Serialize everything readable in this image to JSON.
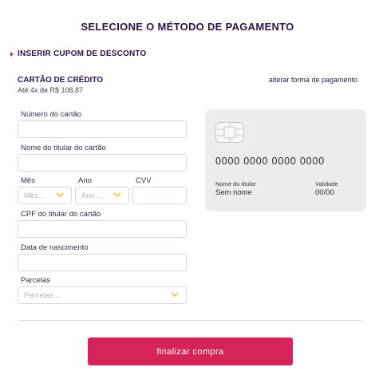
{
  "page": {
    "title": "SELECIONE O MÉTODO DE PAGAMENTO"
  },
  "coupon": {
    "label": "INSERIR CUPOM DE DESCONTO"
  },
  "method": {
    "title": "CARTÃO DE CRÉDITO",
    "installments_text": "Até 4x de R$ 108,87",
    "change_link": "alterar forma de pagamento"
  },
  "form": {
    "card_number_label": "Número do cartão",
    "holder_name_label": "Nome do titular do cartão",
    "month_label": "Mês",
    "month_placeholder": "Mês...",
    "year_label": "Ano",
    "year_placeholder": "Ano...",
    "cvv_label": "CVV",
    "cpf_label": "CPF do titular do cartão",
    "birth_label": "Data de nascimento",
    "installments_label": "Parcelas",
    "installments_placeholder": "Parcelas..."
  },
  "card_preview": {
    "number": "0000 0000 0000 0000",
    "holder_label": "Nome do titular",
    "holder_value": "Sem nome",
    "expiry_label": "Validade",
    "expiry_value": "00/00",
    "chip_icon": "card-chip-icon"
  },
  "actions": {
    "submit_label": "finalizar compra"
  },
  "colors": {
    "accent": "#d6245a",
    "text_dark": "#2b1448",
    "card_bg": "#ececec",
    "chevron": "#f0b429"
  }
}
